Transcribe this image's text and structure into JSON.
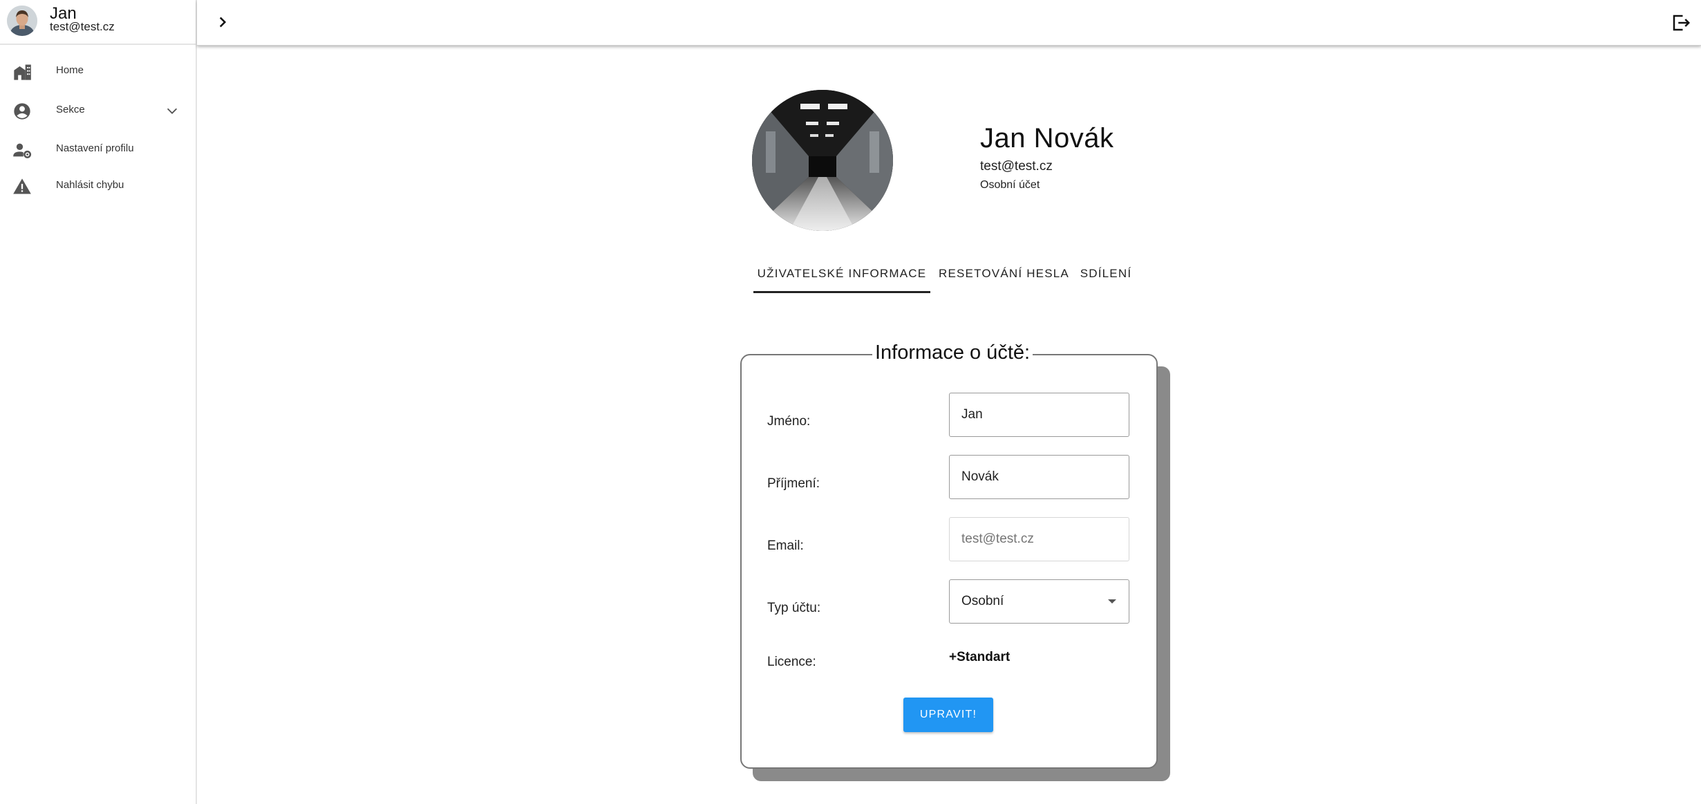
{
  "sidebar": {
    "user": {
      "name": "Jan",
      "email": "test@test.cz"
    },
    "items": [
      {
        "label": "Home",
        "icon": "home-buildings-icon"
      },
      {
        "label": "Sekce",
        "icon": "account-circle-icon",
        "expandable": true
      },
      {
        "label": "Nastavení profilu",
        "icon": "user-settings-icon"
      },
      {
        "label": "Nahlásit chybu",
        "icon": "warning-triangle-icon"
      }
    ]
  },
  "topbar": {
    "toggle_icon": "chevron-right-icon",
    "logout_icon": "logout-icon"
  },
  "profile": {
    "full_name": "Jan Novák",
    "email": "test@test.cz",
    "account_type": "Osobní účet"
  },
  "tabs": [
    {
      "label": "UŽIVATELSKÉ INFORMACE",
      "active": true
    },
    {
      "label": "RESETOVÁNÍ HESLA",
      "active": false
    },
    {
      "label": "SDÍLENÍ",
      "active": false
    }
  ],
  "form": {
    "legend": "Informace o účtě:",
    "first_name": {
      "label": "Jméno:",
      "value": "Jan"
    },
    "last_name": {
      "label": "Příjmení:",
      "value": "Novák"
    },
    "email": {
      "label": "Email:",
      "placeholder": "test@test.cz"
    },
    "account_type": {
      "label": "Typ účtu:",
      "value": "Osobní"
    },
    "licence": {
      "label": "Licence:",
      "value": "+Standart"
    },
    "submit_label": "UPRAVIT!"
  },
  "colors": {
    "accent": "#2196f3",
    "card_shadow": "#8a8a8a"
  }
}
